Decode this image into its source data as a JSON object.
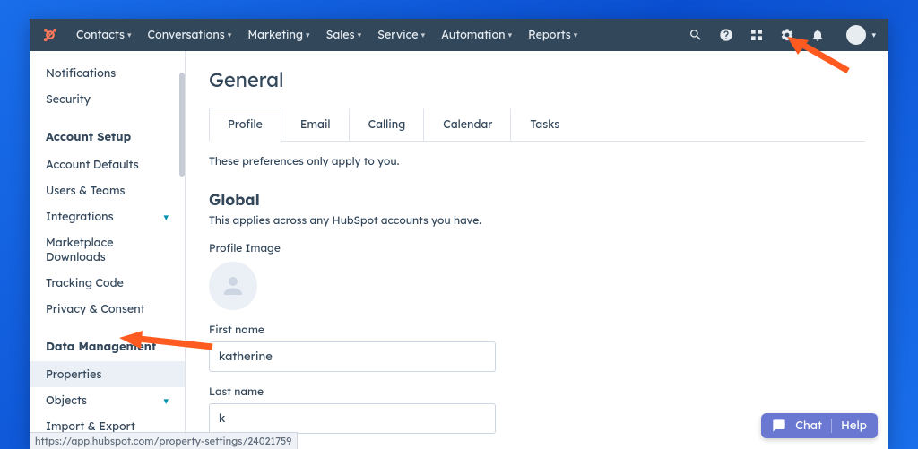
{
  "nav": {
    "items": [
      {
        "label": "Contacts"
      },
      {
        "label": "Conversations"
      },
      {
        "label": "Marketing"
      },
      {
        "label": "Sales"
      },
      {
        "label": "Service"
      },
      {
        "label": "Automation"
      },
      {
        "label": "Reports"
      }
    ]
  },
  "sidebar": {
    "prefs": {
      "items": [
        {
          "label": "Notifications"
        },
        {
          "label": "Security"
        }
      ]
    },
    "account_setup": {
      "header": "Account Setup",
      "items": [
        {
          "label": "Account Defaults"
        },
        {
          "label": "Users & Teams"
        },
        {
          "label": "Integrations",
          "expandable": true
        },
        {
          "label": "Marketplace Downloads"
        },
        {
          "label": "Tracking Code"
        },
        {
          "label": "Privacy & Consent"
        }
      ]
    },
    "data_mgmt": {
      "header": "Data Management",
      "items": [
        {
          "label": "Properties",
          "active": true
        },
        {
          "label": "Objects",
          "expandable": true
        },
        {
          "label": "Import & Export"
        }
      ]
    }
  },
  "page": {
    "title": "General",
    "tabs": [
      {
        "label": "Profile",
        "active": true
      },
      {
        "label": "Email"
      },
      {
        "label": "Calling"
      },
      {
        "label": "Calendar"
      },
      {
        "label": "Tasks"
      }
    ],
    "subtext": "These preferences only apply to you.",
    "global": {
      "title": "Global",
      "subtitle": "This applies across any HubSpot accounts you have.",
      "profile_image_label": "Profile Image",
      "first_name_label": "First name",
      "first_name_value": "katherine",
      "last_name_label": "Last name",
      "last_name_value": "k"
    }
  },
  "help": {
    "chat_label": "Chat",
    "help_label": "Help"
  },
  "url_preview": "https://app.hubspot.com/property-settings/24021759"
}
